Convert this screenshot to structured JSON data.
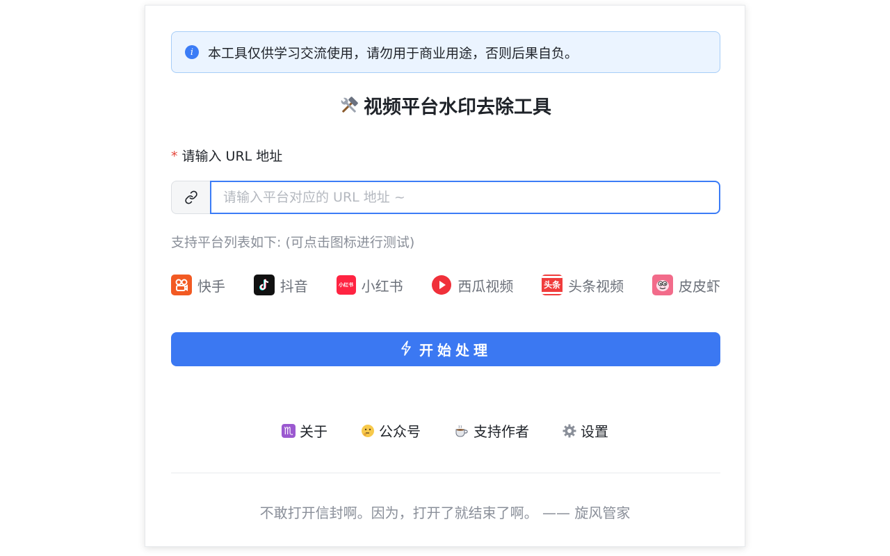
{
  "alert": {
    "text": "本工具仅供学习交流使用，请勿用于商业用途，否则后果自负。"
  },
  "title": "视频平台水印去除工具",
  "form": {
    "required_mark": "*",
    "label": "请输入 URL 地址",
    "placeholder": "请输入平台对应的 URL 地址 ~",
    "value": ""
  },
  "support_text": "支持平台列表如下: (可点击图标进行测试)",
  "platforms": [
    {
      "label": "快手",
      "icon": "kuaishou-icon"
    },
    {
      "label": "抖音",
      "icon": "douyin-icon"
    },
    {
      "label": "小红书",
      "icon": "xiaohongshu-icon"
    },
    {
      "label": "西瓜视频",
      "icon": "xigua-icon"
    },
    {
      "label": "头条视频",
      "icon": "toutiao-icon"
    },
    {
      "label": "皮皮虾",
      "icon": "pipixia-icon"
    }
  ],
  "xhs_icon_text": "小红书",
  "toutiao_icon_text": "头条",
  "start_button": "开始处理",
  "links": [
    {
      "emoji": "♏",
      "label": "关于"
    },
    {
      "emoji": "🤔",
      "label": "公众号"
    },
    {
      "emoji": "☕",
      "label": "支持作者"
    },
    {
      "emoji": "⚙",
      "label": "设置"
    }
  ],
  "quote": "不敢打开信封啊。因为，打开了就结束了啊。 —— 旋风管家",
  "colors": {
    "primary": "#3b78f2",
    "alert_bg": "#ebf4ff",
    "alert_border": "#a6cdf7",
    "required": "#e5483d",
    "muted": "#8a8f99"
  }
}
